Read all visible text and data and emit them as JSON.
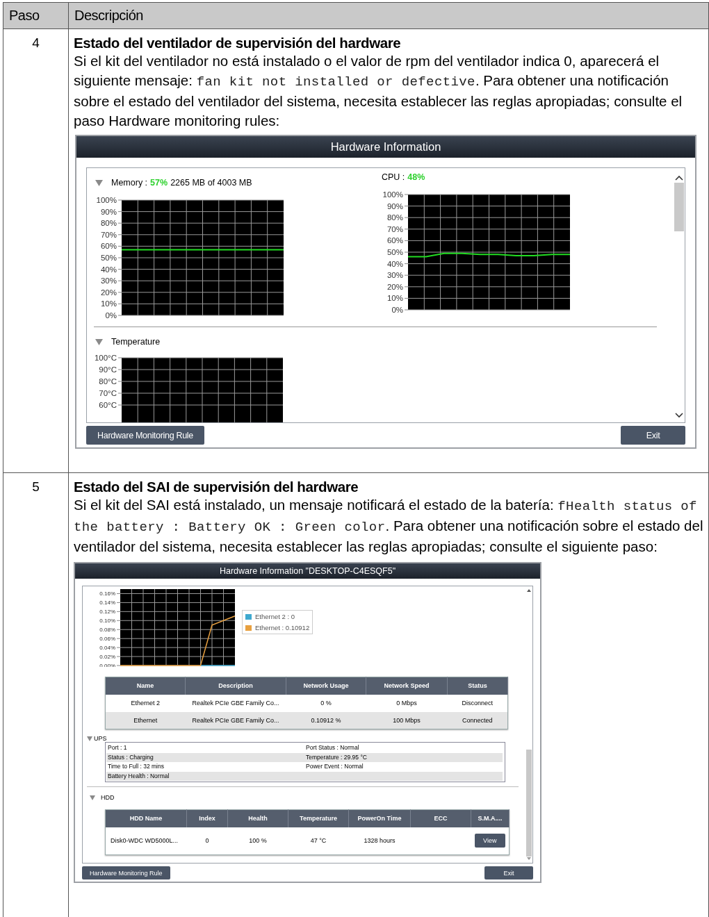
{
  "table": {
    "columns": [
      "Paso",
      "Descripción"
    ],
    "rows": [
      {
        "step": "4",
        "title": "Estado del ventilador de supervisión del hardware",
        "body": [
          {
            "kind": "text",
            "text": "Si el kit del ventilador no está instalado o el valor de rpm del ventilador indica 0, aparecerá el siguiente mensaje: "
          },
          {
            "kind": "code",
            "text": "fan kit not installed or defective"
          },
          {
            "kind": "text",
            "text": ". Para obtener una notificación sobre el estado del ventilador del sistema, necesita establecer las reglas apropiadas; consulte el paso Hardware monitoring rules:"
          }
        ],
        "window": {
          "kind": "fan",
          "title": "Hardware Information",
          "memory": {
            "label": "Memory :",
            "value": "57%",
            "detail": "2265 MB of 4003 MB",
            "expanded": true,
            "chart_data": {
              "type": "line",
              "grid": true,
              "ylim": [
                0,
                100
              ],
              "yticks": [
                {
                  "value": 0,
                  "label": "0%"
                },
                {
                  "value": 10,
                  "label": "10%"
                },
                {
                  "value": 20,
                  "label": "20%"
                },
                {
                  "value": 30,
                  "label": "30%"
                },
                {
                  "value": 40,
                  "label": "40%"
                },
                {
                  "value": 50,
                  "label": "50%"
                },
                {
                  "value": 60,
                  "label": "60%"
                },
                {
                  "value": 70,
                  "label": "70%"
                },
                {
                  "value": 80,
                  "label": "80%"
                },
                {
                  "value": 90,
                  "label": "90%"
                },
                {
                  "value": 100,
                  "label": "100%"
                }
              ],
              "series": [
                {
                  "color": "#22dd22",
                  "values": [
                    57,
                    57,
                    57,
                    57,
                    57,
                    57,
                    57,
                    57,
                    57,
                    57,
                    57
                  ]
                }
              ]
            }
          },
          "cpu": {
            "label": "CPU :",
            "value": "48%",
            "chart_data": {
              "type": "line",
              "grid": true,
              "ylim": [
                0,
                100
              ],
              "yticks": [
                {
                  "value": 0,
                  "label": "0%"
                },
                {
                  "value": 10,
                  "label": "10%"
                },
                {
                  "value": 20,
                  "label": "20%"
                },
                {
                  "value": 30,
                  "label": "30%"
                },
                {
                  "value": 40,
                  "label": "40%"
                },
                {
                  "value": 50,
                  "label": "50%"
                },
                {
                  "value": 60,
                  "label": "60%"
                },
                {
                  "value": 70,
                  "label": "70%"
                },
                {
                  "value": 80,
                  "label": "80%"
                },
                {
                  "value": 90,
                  "label": "90%"
                },
                {
                  "value": 100,
                  "label": "100%"
                }
              ],
              "series": [
                {
                  "color": "#22dd22",
                  "values": [
                    46,
                    46,
                    49,
                    49,
                    48,
                    48,
                    47,
                    47,
                    48,
                    48
                  ]
                }
              ]
            }
          },
          "temperature": {
            "label": "Temperature",
            "expanded": true,
            "ticks": [
              "100°C",
              "90°C",
              "80°C",
              "70°C",
              "60°C"
            ]
          },
          "buttons": [
            "Hardware Monitoring Rule",
            "Exit"
          ]
        }
      },
      {
        "step": "5",
        "title": "Estado del SAI de supervisión del hardware",
        "body": [
          {
            "kind": "text",
            "text": "Si el kit del SAI está instalado, un mensaje notificará el estado de la batería: "
          },
          {
            "kind": "code",
            "text": "fHealth status of the battery : Battery OK : Green color"
          },
          {
            "kind": "text",
            "text": ". Para obtener una notificación sobre el estado del ventilador del sistema, necesita establecer las reglas apropiadas; consulte el siguiente paso:"
          }
        ],
        "window": {
          "kind": "ups",
          "title": "Hardware Information \"DESKTOP-C4ESQF5\"",
          "network": {
            "chart_data": {
              "type": "line",
              "grid": true,
              "ylim": [
                0,
                0.17
              ],
              "yticks": [
                {
                  "value": 0,
                  "label": "0.00%"
                },
                {
                  "value": 0.02,
                  "label": "0.02%"
                },
                {
                  "value": 0.04,
                  "label": "0.04%"
                },
                {
                  "value": 0.06,
                  "label": "0.06%"
                },
                {
                  "value": 0.08,
                  "label": "0.08%"
                },
                {
                  "value": 0.1,
                  "label": "0.10%"
                },
                {
                  "value": 0.12,
                  "label": "0.12%"
                },
                {
                  "value": 0.14,
                  "label": "0.14%"
                },
                {
                  "value": 0.16,
                  "label": "0.16%"
                }
              ],
              "series": [
                {
                  "name": "Ethernet 2 : 0",
                  "color": "#3fa9cf",
                  "values": [
                    null,
                    null,
                    null,
                    null,
                    null,
                    null,
                    null,
                    0,
                    0,
                    0,
                    0
                  ]
                },
                {
                  "name": "Ethernet : 0.10912",
                  "color": "#e8a040",
                  "values": [
                    0,
                    0,
                    0,
                    0,
                    0,
                    0,
                    0,
                    0,
                    0.09,
                    0.1,
                    0.11
                  ]
                }
              ]
            },
            "columns": [
              "Name",
              "Description",
              "Network Usage",
              "Network Speed",
              "Status"
            ],
            "rows": [
              [
                "Ethernet 2",
                "Realtek PCIe GBE Family Co...",
                "0 %",
                "0 Mbps",
                "Disconnect"
              ],
              [
                "Ethernet",
                "Realtek PCIe GBE Family Co...",
                "0.10912 %",
                "100 Mbps",
                "Connected"
              ]
            ]
          },
          "ups": {
            "label": "UPS",
            "expanded": true,
            "left": [
              "Port : 1",
              "Status : Charging",
              "Time to Full : 32 mins",
              "Battery Health : Normal"
            ],
            "right": [
              "Port Status : Normal",
              "Temperature : 29.95 °C",
              "Power Event : Normal"
            ]
          },
          "hdd": {
            "label": "HDD",
            "expanded": true,
            "columns": [
              "HDD Name",
              "Index",
              "Health",
              "Temperature",
              "PowerOn Time",
              "ECC",
              "S.M.A...."
            ],
            "rows": [
              {
                "cells": [
                  "Disk0-WDC WD5000L...",
                  "0",
                  "100 %",
                  "47 °C",
                  "1328 hours",
                  ""
                ],
                "action": "View"
              }
            ]
          },
          "buttons": [
            "Hardware Monitoring Rule",
            "Exit"
          ]
        }
      }
    ]
  }
}
